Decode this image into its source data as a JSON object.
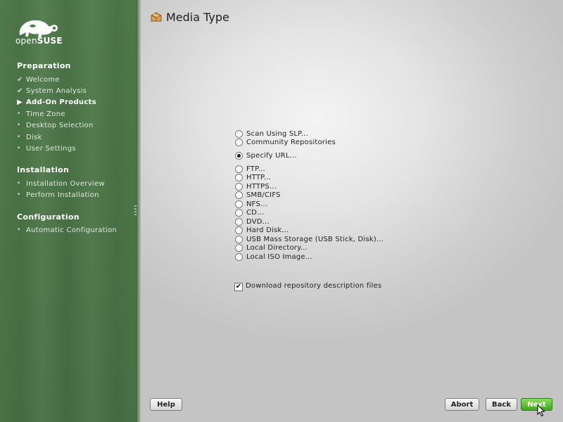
{
  "brand": {
    "name_light": "open",
    "name_bold": "SUSE",
    "accent": "#4e7849"
  },
  "sidebar": {
    "sections": [
      {
        "title": "Preparation",
        "steps": [
          {
            "label": "Welcome",
            "state": "done"
          },
          {
            "label": "System Analysis",
            "state": "done"
          },
          {
            "label": "Add-On Products",
            "state": "current"
          },
          {
            "label": "Time Zone",
            "state": "pending"
          },
          {
            "label": "Desktop Selection",
            "state": "pending"
          },
          {
            "label": "Disk",
            "state": "pending"
          },
          {
            "label": "User Settings",
            "state": "pending"
          }
        ]
      },
      {
        "title": "Installation",
        "steps": [
          {
            "label": "Installation Overview",
            "state": "pending"
          },
          {
            "label": "Perform Installation",
            "state": "pending"
          }
        ]
      },
      {
        "title": "Configuration",
        "steps": [
          {
            "label": "Automatic Configuration",
            "state": "pending"
          }
        ]
      }
    ]
  },
  "main": {
    "title": "Media Type",
    "title_icon": "package-icon",
    "options_group1": [
      {
        "label": "Scan Using SLP...",
        "checked": false
      },
      {
        "label": "Community Repositories",
        "checked": false
      }
    ],
    "options_group2": [
      {
        "label": "Specify URL...",
        "checked": true
      }
    ],
    "options_group3": [
      {
        "label": "FTP...",
        "checked": false
      },
      {
        "label": "HTTP...",
        "checked": false
      },
      {
        "label": "HTTPS...",
        "checked": false
      },
      {
        "label": "SMB/CIFS",
        "checked": false
      },
      {
        "label": "NFS...",
        "checked": false
      },
      {
        "label": "CD...",
        "checked": false
      },
      {
        "label": "DVD...",
        "checked": false
      },
      {
        "label": "Hard Disk...",
        "checked": false
      },
      {
        "label": "USB Mass Storage (USB Stick, Disk)...",
        "checked": false
      },
      {
        "label": "Local Directory...",
        "checked": false
      },
      {
        "label": "Local ISO Image...",
        "checked": false
      }
    ],
    "download_checkbox": {
      "label": "Download repository description files",
      "checked": true
    }
  },
  "buttons": {
    "help": "Help",
    "abort": "Abort",
    "back": "Back",
    "next": "Next"
  }
}
